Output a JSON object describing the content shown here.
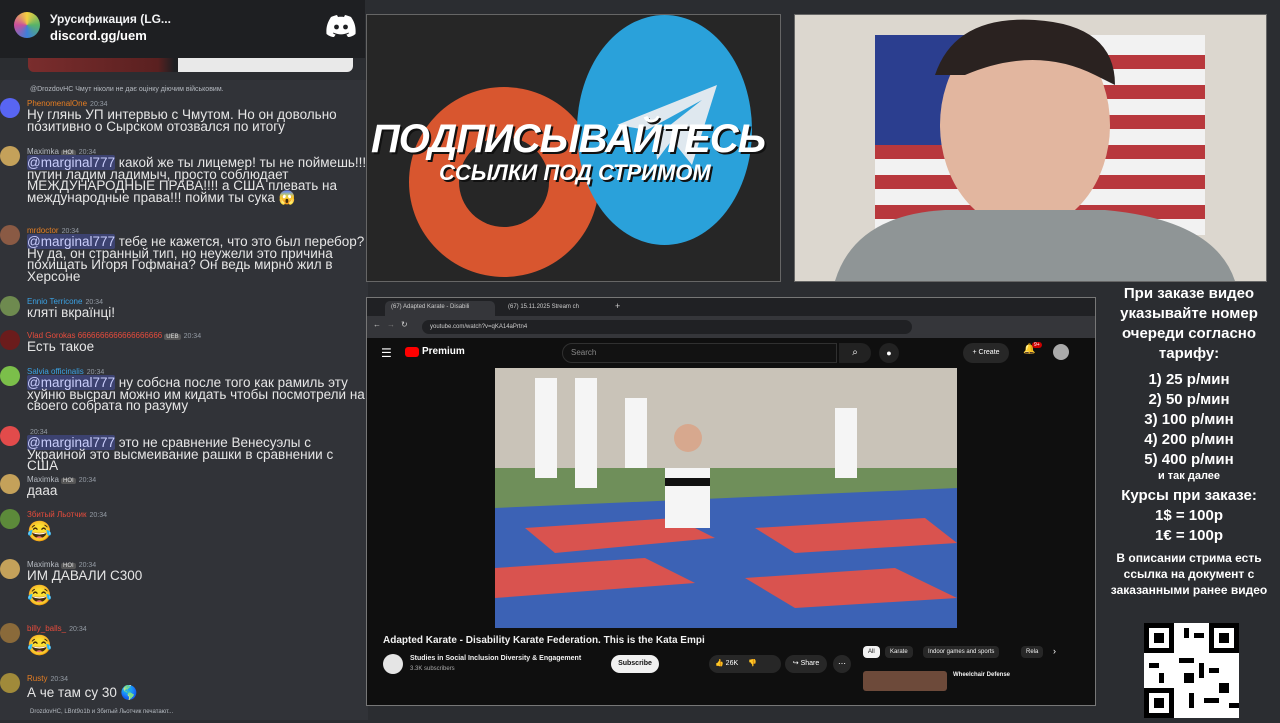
{
  "discord": {
    "server_name": "Урусификация (LG...",
    "invite": "discord.gg/uem"
  },
  "chat": {
    "reply_preview": "@DrozdovHC Чмут ніколи не дає оцінку діючим військовим.",
    "messages": [
      {
        "user": "PhenomenalOne",
        "color": "#e67e22",
        "time": "20:34",
        "text": "Ну глянь УП интервью с Чмутом. Но он довольно\nпозитивно о Сырском отозвался по итогу"
      },
      {
        "user": "Maximka",
        "badge": "HOI",
        "color": "#b5bac1",
        "time": "20:34",
        "mention": "@marginal777",
        "text": " какой же ты лицемер! ты не поймешь!!!\nпутин ладим ладимыч, просто соблюдает\nМЕЖДУНАРОДНЫЕ ПРАВА!!!! а США плевать на\nмеждународные права!!! пойми ты сука 😱"
      },
      {
        "user": "mrdoctor",
        "color": "#e67e22",
        "time": "20:34",
        "mention": "@marginal777",
        "text": " тебе не кажется, что это был перебор?\nНу да, он странный тип, но неужели это причина\nпохищать Игоря Гофмана? Он ведь мирно жил в\nХерсоне"
      },
      {
        "user": "Ennio Terricone",
        "color": "#3ba3e5",
        "time": "20:34",
        "text": "кляті вкраїнці!"
      },
      {
        "user": "Vlad Gorokas 6666666666666666666",
        "badge": "UEB",
        "color": "#e74c3c",
        "time": "20:34",
        "text": "Есть такое"
      },
      {
        "user": "Salvia officinalis",
        "color": "#3ba3e5",
        "time": "20:34",
        "mention": "@marginal777",
        "text": " ну собсна после того как рамиль эту\nхуйню высрал можно им кидать чтобы посмотрели на\nсвоего собрата по разуму"
      },
      {
        "user": "",
        "color": "#b5bac1",
        "time": "20:34",
        "mention": "@marginal777",
        "text": " это не сравнение Венесуэлы с\nУкраиной это высмеивание рашки в сравнении с США"
      },
      {
        "user": "Maximka",
        "badge": "HOI",
        "color": "#b5bac1",
        "time": "20:34",
        "text": "дааа"
      },
      {
        "user": "Збитый Льотчик",
        "color": "#e74c3c",
        "time": "20:34",
        "text": "😂"
      },
      {
        "user": "Maximka",
        "badge": "HOI",
        "color": "#b5bac1",
        "time": "20:34",
        "text": "ИМ ДАВАЛИ С300"
      },
      {
        "user": "billy_balls_",
        "color": "#e74c3c",
        "time": "20:34",
        "text": "😂"
      },
      {
        "user": "Rusty",
        "color": "#e67e22",
        "time": "20:34",
        "text": "А че там су 30 🌎"
      }
    ],
    "typing": "DrozdovHC, LBnt9o1b и Збитый Льотчик печатают..."
  },
  "promo": {
    "headline": "ПОДПИСЫВАЙТЕСЬ",
    "sub": "ССЫЛКИ ПОД СТРИМОМ"
  },
  "browser": {
    "tabs": [
      "(67) Adapted Karate - Disabili",
      "(67) 15.11.2025 Stream ch"
    ],
    "url": "youtube.com/watch?v=qKA14aPrtn4",
    "search_placeholder": "Search",
    "create_label": "Create",
    "notif_count": "9+",
    "logo_text": "Premium",
    "video_title": "Adapted Karate - Disability Karate Federation. This is the Kata Empi",
    "channel_name": "Studies in Social Inclusion Diversity & Engagement",
    "subscribers": "3.3K subscribers",
    "subscribe_label": "Subscribe",
    "likes": "26K",
    "share_label": "Share",
    "chips": [
      "All",
      "Karate",
      "Indoor games and sports",
      "Rela"
    ],
    "next_video": "Wheelchair Defense"
  },
  "info": {
    "order_note": "При заказе видео указывайте номер очереди согласно тарифу:",
    "tariffs": [
      "1) 25 р/мин",
      "2) 50 р/мин",
      "3) 100 р/мин",
      "4) 200 р/мин",
      "5) 400 р/мин"
    ],
    "etc": "и так далее",
    "rates_title": "Курсы при заказе:",
    "rates": [
      "1$ = 100р",
      "1€ = 100р"
    ],
    "desc_note": "В описании стрима есть ссылка на документ с заказанными ранее видео"
  }
}
